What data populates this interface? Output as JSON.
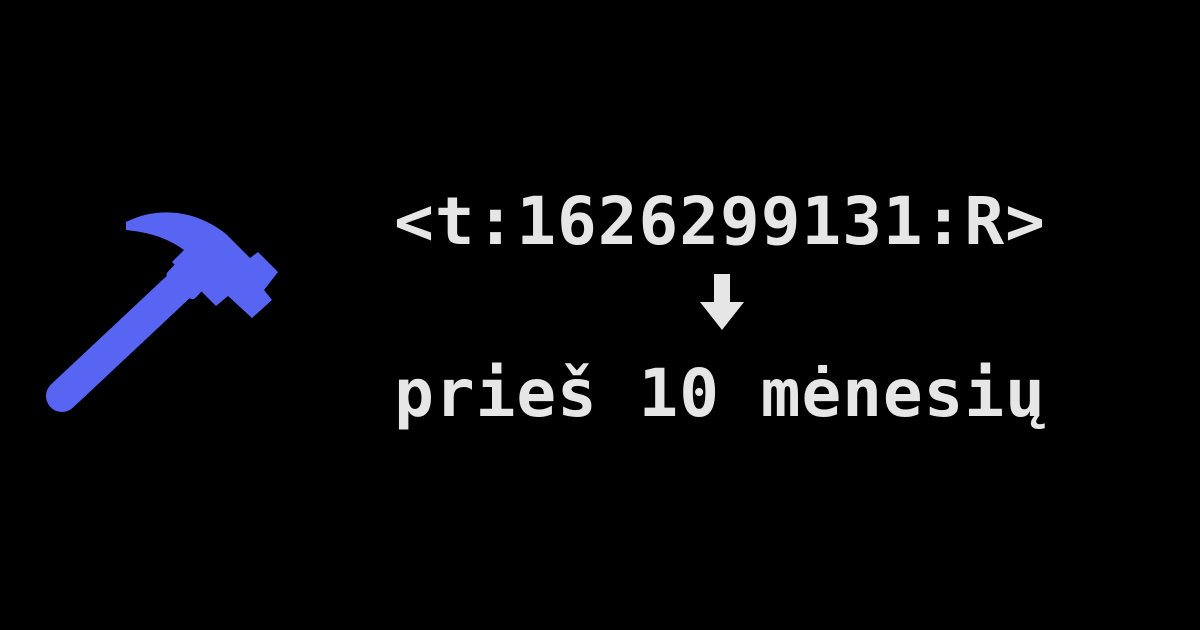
{
  "timestamp_markup": "<t:1626299131:R>",
  "rendered_text": "prieš 10 mėnesių",
  "icons": {
    "tool": "hammer-icon",
    "direction": "down-arrow-icon"
  },
  "colors": {
    "background": "#000000",
    "text": "#e6e6e6",
    "hammer": "#5865f2"
  }
}
